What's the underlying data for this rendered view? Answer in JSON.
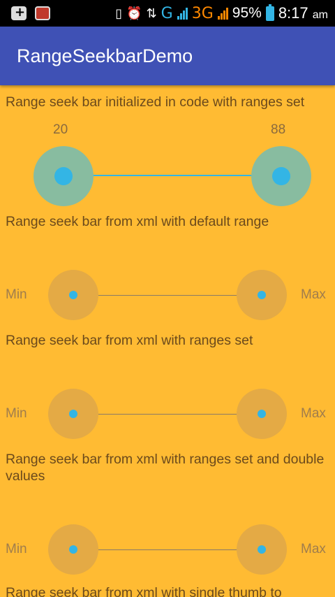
{
  "status_bar": {
    "signal_g": "G",
    "signal_3g": "3G",
    "battery_percent": "95%",
    "time": "8:17",
    "time_suffix": "am"
  },
  "app_bar": {
    "title": "RangeSeekbarDemo"
  },
  "sections": [
    {
      "label": "Range seek bar initialized in code with ranges set",
      "min_value": "20",
      "max_value": "88"
    },
    {
      "label": "Range seek bar from xml with default range",
      "min_label": "Min",
      "max_label": "Max"
    },
    {
      "label": "Range seek bar from xml with ranges set",
      "min_label": "Min",
      "max_label": "Max"
    },
    {
      "label": "Range seek bar from xml with ranges set and double values",
      "min_label": "Min",
      "max_label": "Max"
    },
    {
      "label": "Range seek bar from xml with single thumb to"
    }
  ],
  "colors": {
    "background": "#FFBB33",
    "app_bar": "#3F51B5",
    "accent": "#33B5E5",
    "active_halo": "#88BCA0",
    "inactive_halo": "#E4AA45"
  }
}
